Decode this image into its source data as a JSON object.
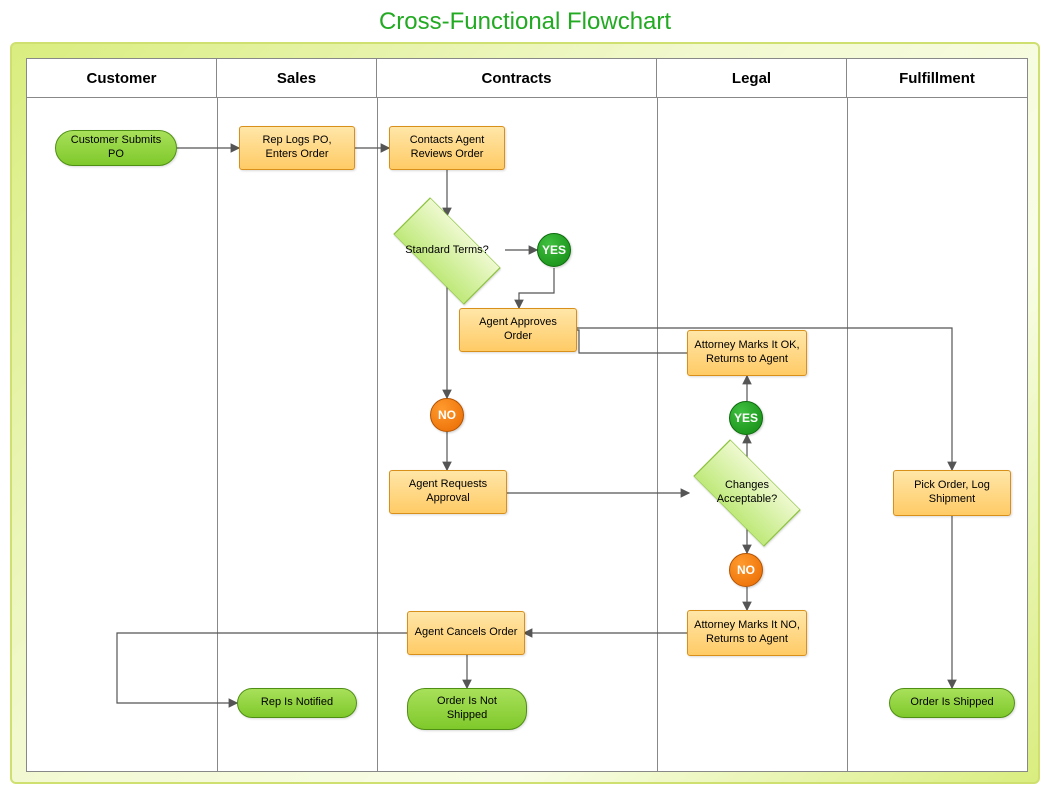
{
  "title": "Cross-Functional Flowchart",
  "lanes": {
    "customer": "Customer",
    "sales": "Sales",
    "contracts": "Contracts",
    "legal": "Legal",
    "fulfillment": "Fulfillment"
  },
  "nodes": {
    "customer_submits": "Customer Submits PO",
    "rep_logs": "Rep Logs PO, Enters Order",
    "reviews_order": "Contacts Agent Reviews Order",
    "standard_terms": "Standard Terms?",
    "approves_order": "Agent Approves Order",
    "requests_approval": "Agent Requests Approval",
    "changes_acceptable": "Changes Acceptable?",
    "attorney_ok": "Attorney Marks It OK, Returns to Agent",
    "attorney_no": "Attorney Marks It NO, Returns to Agent",
    "cancels_order": "Agent Cancels Order",
    "pick_order": "Pick Order, Log Shipment",
    "rep_notified": "Rep Is Notified",
    "not_shipped": "Order Is Not Shipped",
    "shipped": "Order Is Shipped"
  },
  "labels": {
    "yes": "YES",
    "no": "NO"
  },
  "chart_data": {
    "type": "flowchart",
    "title": "Cross-Functional Flowchart",
    "swimlanes": [
      "Customer",
      "Sales",
      "Contracts",
      "Legal",
      "Fulfillment"
    ],
    "nodes": [
      {
        "id": "customer_submits",
        "lane": "Customer",
        "type": "terminator",
        "label": "Customer Submits PO"
      },
      {
        "id": "rep_logs",
        "lane": "Sales",
        "type": "process",
        "label": "Rep Logs PO, Enters Order"
      },
      {
        "id": "reviews_order",
        "lane": "Contracts",
        "type": "process",
        "label": "Contacts Agent Reviews Order"
      },
      {
        "id": "standard_terms",
        "lane": "Contracts",
        "type": "decision",
        "label": "Standard Terms?"
      },
      {
        "id": "yes1",
        "lane": "Contracts",
        "type": "connector",
        "label": "YES"
      },
      {
        "id": "approves_order",
        "lane": "Contracts",
        "type": "process",
        "label": "Agent Approves Order"
      },
      {
        "id": "no1",
        "lane": "Contracts",
        "type": "connector",
        "label": "NO"
      },
      {
        "id": "requests_approval",
        "lane": "Contracts",
        "type": "process",
        "label": "Agent Requests Approval"
      },
      {
        "id": "changes_acceptable",
        "lane": "Legal",
        "type": "decision",
        "label": "Changes Acceptable?"
      },
      {
        "id": "yes2",
        "lane": "Legal",
        "type": "connector",
        "label": "YES"
      },
      {
        "id": "attorney_ok",
        "lane": "Legal",
        "type": "process",
        "label": "Attorney Marks It OK, Returns to Agent"
      },
      {
        "id": "no2",
        "lane": "Legal",
        "type": "connector",
        "label": "NO"
      },
      {
        "id": "attorney_no",
        "lane": "Legal",
        "type": "process",
        "label": "Attorney Marks It NO, Returns to Agent"
      },
      {
        "id": "cancels_order",
        "lane": "Contracts",
        "type": "process",
        "label": "Agent Cancels Order"
      },
      {
        "id": "rep_notified",
        "lane": "Sales",
        "type": "terminator",
        "label": "Rep Is Notified"
      },
      {
        "id": "not_shipped",
        "lane": "Contracts",
        "type": "terminator",
        "label": "Order Is Not Shipped"
      },
      {
        "id": "pick_order",
        "lane": "Fulfillment",
        "type": "process",
        "label": "Pick Order, Log Shipment"
      },
      {
        "id": "shipped",
        "lane": "Fulfillment",
        "type": "terminator",
        "label": "Order Is Shipped"
      }
    ],
    "edges": [
      {
        "from": "customer_submits",
        "to": "rep_logs"
      },
      {
        "from": "rep_logs",
        "to": "reviews_order"
      },
      {
        "from": "reviews_order",
        "to": "standard_terms"
      },
      {
        "from": "standard_terms",
        "to": "yes1",
        "label": "YES"
      },
      {
        "from": "yes1",
        "to": "approves_order"
      },
      {
        "from": "standard_terms",
        "to": "no1",
        "label": "NO"
      },
      {
        "from": "no1",
        "to": "requests_approval"
      },
      {
        "from": "requests_approval",
        "to": "changes_acceptable"
      },
      {
        "from": "changes_acceptable",
        "to": "yes2",
        "label": "YES"
      },
      {
        "from": "yes2",
        "to": "attorney_ok"
      },
      {
        "from": "attorney_ok",
        "to": "approves_order"
      },
      {
        "from": "changes_acceptable",
        "to": "no2",
        "label": "NO"
      },
      {
        "from": "no2",
        "to": "attorney_no"
      },
      {
        "from": "attorney_no",
        "to": "cancels_order"
      },
      {
        "from": "cancels_order",
        "to": "rep_notified"
      },
      {
        "from": "cancels_order",
        "to": "not_shipped"
      },
      {
        "from": "approves_order",
        "to": "pick_order"
      },
      {
        "from": "pick_order",
        "to": "shipped"
      }
    ]
  }
}
